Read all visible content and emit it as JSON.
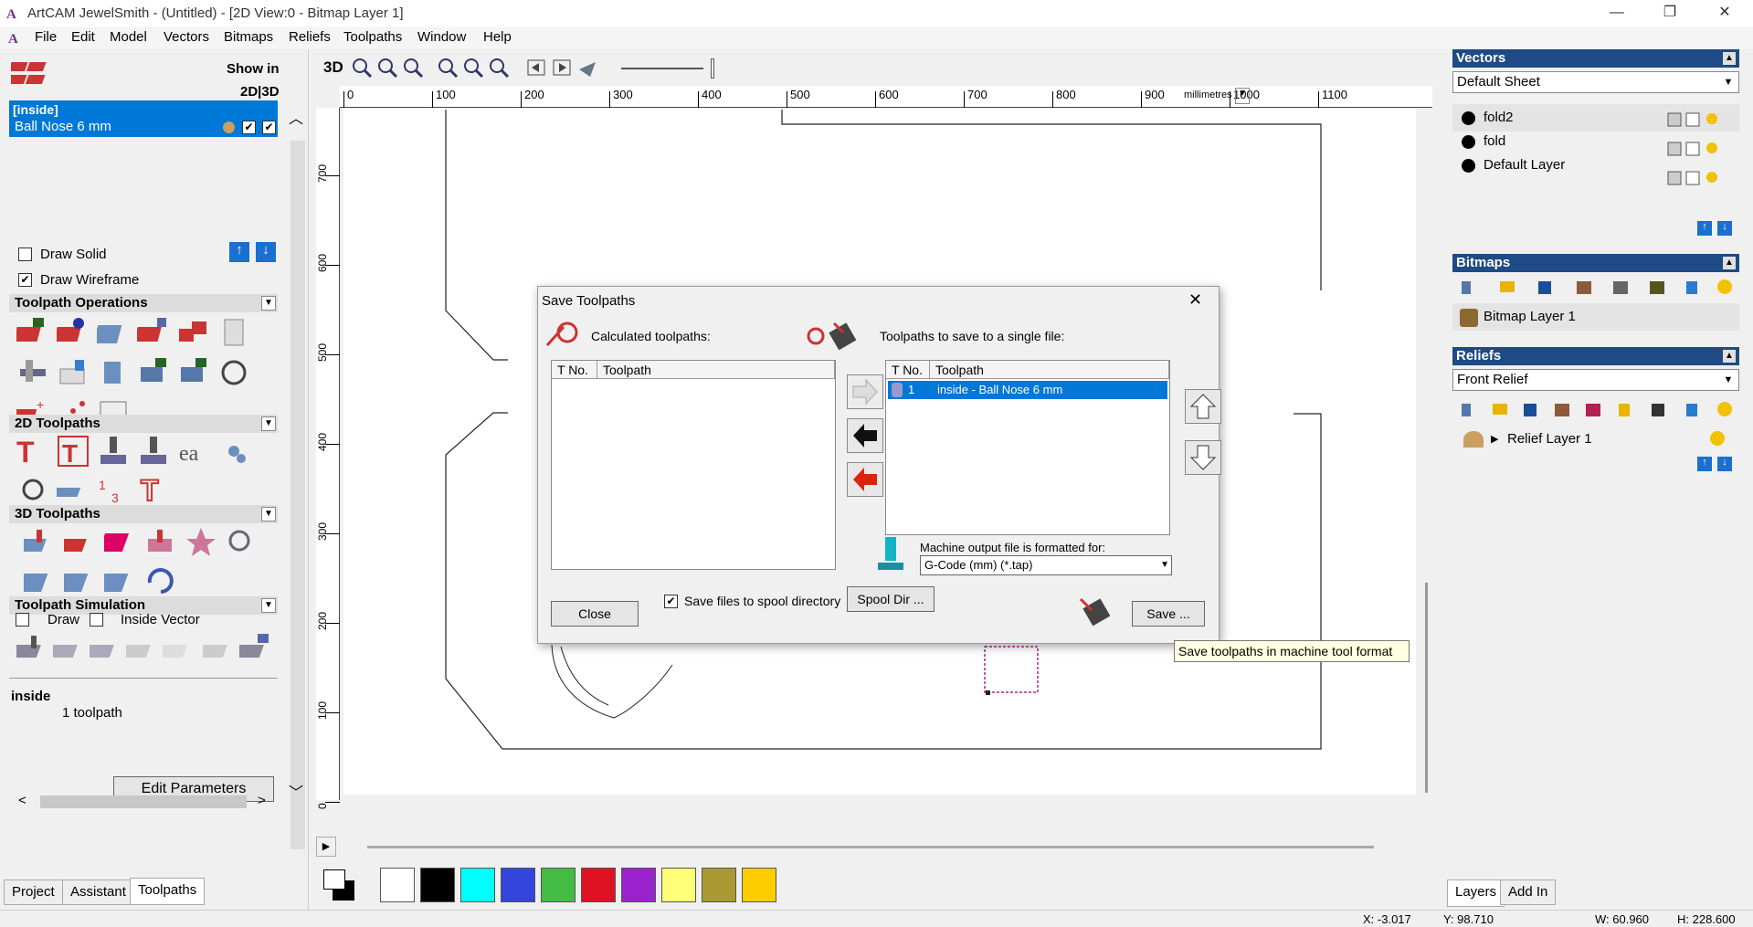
{
  "window": {
    "title": "ArtCAM JewelSmith - (Untitled) - [2D View:0 - Bitmap Layer 1]"
  },
  "menu": [
    "File",
    "Edit",
    "Model",
    "Vectors",
    "Bitmaps",
    "Reliefs",
    "Toolpaths",
    "Window",
    "Help"
  ],
  "left_panel": {
    "show_in": "Show in",
    "show_in_modes": "2D|3D",
    "toolpath_group": "[inside]",
    "toolpath_item": "Ball Nose 6 mm",
    "draw_solid": "Draw Solid",
    "draw_wireframe": "Draw Wireframe",
    "draw_solid_checked": false,
    "draw_wireframe_checked": true,
    "sections": {
      "ops": "Toolpath Operations",
      "t2d": "2D Toolpaths",
      "t3d": "3D Toolpaths",
      "sim": "Toolpath Simulation"
    },
    "sim_draw": "Draw",
    "sim_inside_vector": "Inside Vector",
    "info_name": "inside",
    "info_count": "1 toolpath",
    "edit_parameters": "Edit Parameters",
    "tabs": [
      "Project",
      "Assistant",
      "Toolpaths"
    ],
    "active_tab": "Toolpaths"
  },
  "view_toolbar": {
    "mode_3d": "3D"
  },
  "ruler": {
    "top_ticks": [
      "0",
      "100",
      "200",
      "300",
      "400",
      "500",
      "600",
      "700",
      "800",
      "900",
      "1000",
      "1100"
    ],
    "units": "millimetres",
    "left_ticks": [
      "700",
      "600",
      "500",
      "400",
      "300",
      "200",
      "100",
      "0"
    ]
  },
  "dialog": {
    "title": "Save Toolpaths",
    "calculated_label": "Calculated toolpaths:",
    "to_save_label": "Toolpaths to save to a single file:",
    "col_tno": "T No.",
    "col_toolpath": "Toolpath",
    "saved_rows": [
      {
        "tno": "1",
        "name": "inside - Ball Nose 6 mm"
      }
    ],
    "machine_label": "Machine output file is formatted for:",
    "machine_format": "G-Code (mm) (*.tap)",
    "close": "Close",
    "spool_checkbox": "Save files to spool directory",
    "spool_checked": true,
    "spool_dir": "Spool Dir ...",
    "save": "Save ..."
  },
  "tooltip": "Save toolpaths in machine tool format",
  "right_panel": {
    "vectors_header": "Vectors",
    "vectors_sheet": "Default Sheet",
    "vector_layers": [
      "fold2",
      "fold",
      "Default Layer"
    ],
    "bitmaps_header": "Bitmaps",
    "bitmap_layers": [
      "Bitmap Layer 1"
    ],
    "reliefs_header": "Reliefs",
    "reliefs_combo": "Front Relief",
    "relief_layers": [
      "Relief Layer 1"
    ],
    "tabs": [
      "Layers",
      "Add In"
    ],
    "active_tab": "Layers"
  },
  "palette_colors": [
    "#ffffff",
    "#000000",
    "#00ffff",
    "#3344dd",
    "#44bb44",
    "#dd1122",
    "#9922cc",
    "#ffff77",
    "#aa9933",
    "#ffcc00"
  ],
  "status": {
    "x": "X: -3.017",
    "y": "Y: 98.710",
    "w": "W: 60.960",
    "h": "H: 228.600"
  }
}
